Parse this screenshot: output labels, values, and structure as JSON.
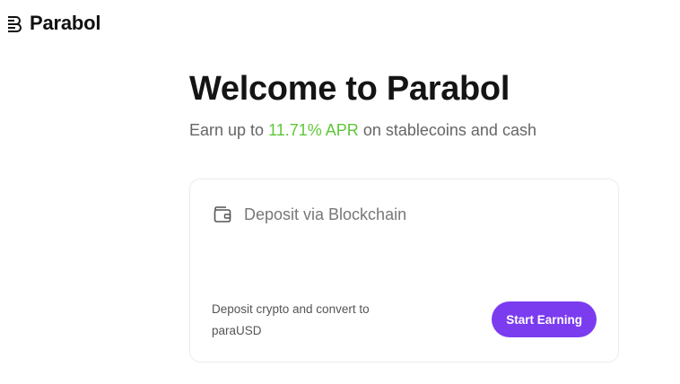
{
  "brand": {
    "name": "Parabol",
    "logo_icon": "parabol-logo-icon"
  },
  "hero": {
    "title": "Welcome to Parabol",
    "subtitle_prefix": "Earn up to",
    "subtitle_highlight": "11.71% APR",
    "subtitle_suffix": "on stablecoins and cash"
  },
  "deposit_card": {
    "icon": "wallet-icon",
    "title": "Deposit via Blockchain",
    "description": "Deposit crypto and convert to paraUSD",
    "button_label": "Start Earning"
  },
  "colors": {
    "accent": "#7b3cf0",
    "highlight": "#5fc73a",
    "text_primary": "#141414",
    "text_secondary": "#666666"
  }
}
